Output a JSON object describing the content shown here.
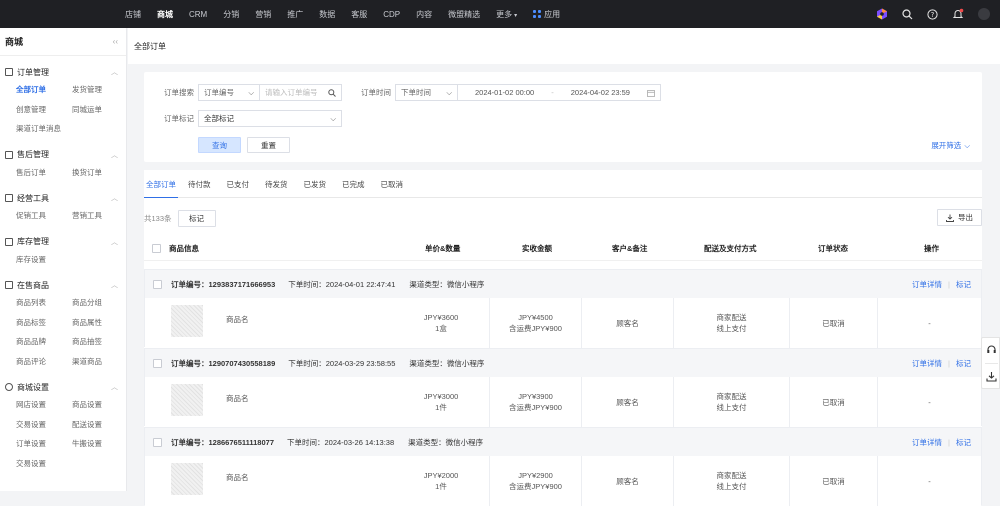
{
  "topnav": {
    "items": [
      "店铺",
      "商城",
      "CRM",
      "分销",
      "营销",
      "推广",
      "数据",
      "客服",
      "CDP",
      "内容",
      "微盟精选",
      "更多"
    ],
    "active": "商城",
    "apps_label": "应用"
  },
  "sidebar": {
    "title": "商城",
    "groups": [
      {
        "name": "订单管理",
        "items": [
          "全部订单",
          "发货管理",
          "创意管理",
          "同城运单",
          "渠道订单消息"
        ]
      },
      {
        "name": "售后管理",
        "items": [
          "售后订单",
          "换货订单"
        ]
      },
      {
        "name": "经营工具",
        "items": [
          "促销工具",
          "营销工具"
        ]
      },
      {
        "name": "库存管理",
        "items": [
          "库存设置"
        ]
      },
      {
        "name": "在售商品",
        "items": [
          "商品列表",
          "商品分组",
          "商品标签",
          "商品属性",
          "商品品牌",
          "商品抽签",
          "商品评论",
          "渠道商品"
        ]
      },
      {
        "name": "商城设置",
        "items": [
          "网店设置",
          "商品设置",
          "交易设置",
          "配送设置",
          "订单设置",
          "牛搬设置",
          "交易设置"
        ]
      }
    ],
    "active_item": "全部订单"
  },
  "breadcrumb": "全部订单",
  "filter": {
    "search_label": "订单搜索",
    "search_type": "订单编号",
    "search_placeholder": "请输入订单编号",
    "time_label": "订单时间",
    "time_type": "下单时间",
    "date_start": "2024-01-02 00:00",
    "date_sep": "-",
    "date_end": "2024-04-02 23:59",
    "mark_label": "订单标记",
    "mark_value": "全部标记",
    "query_button": "查询",
    "reset_button": "重置",
    "expand_label": "展开筛选"
  },
  "tabs": [
    "全部订单",
    "待付款",
    "已支付",
    "待发货",
    "已发货",
    "已完成",
    "已取消"
  ],
  "active_tab": "全部订单",
  "list": {
    "count": "共133条",
    "mark_button": "标记",
    "export_button": "导出",
    "headers": [
      "商品信息",
      "单价&数量",
      "实收金额",
      "客户&备注",
      "配送及支付方式",
      "订单状态",
      "操作"
    ]
  },
  "orders": [
    {
      "no_label": "订单编号：",
      "no": "1293837171666953",
      "time": "下单时间：2024-04-01 22:47:41",
      "channel": "渠道类型：微信小程序",
      "detail": "订单详情",
      "mark": "标记",
      "product": "商品名",
      "price": "JPY¥3600",
      "qty": "1盒",
      "paid": "JPY¥4500",
      "shipping_fee": "含运费JPY¥900",
      "customer": "顾客名",
      "delivery": "商家配送",
      "payment": "线上支付",
      "status": "已取消",
      "action": "-"
    },
    {
      "no_label": "订单编号：",
      "no": "1290707430558189",
      "time": "下单时间：2024-03-29 23:58:55",
      "channel": "渠道类型：微信小程序",
      "detail": "订单详情",
      "mark": "标记",
      "product": "商品名",
      "price": "JPY¥3000",
      "qty": "1件",
      "paid": "JPY¥3900",
      "shipping_fee": "含运费JPY¥900",
      "customer": "顾客名",
      "delivery": "商家配送",
      "payment": "线上支付",
      "status": "已取消",
      "action": "-"
    },
    {
      "no_label": "订单编号：",
      "no": "1286676511118077",
      "time": "下单时间：2024-03-26 14:13:38",
      "channel": "渠道类型：微信小程序",
      "detail": "订单详情",
      "mark": "标记",
      "product": "商品名",
      "price": "JPY¥2000",
      "qty": "1件",
      "paid": "JPY¥2900",
      "shipping_fee": "含运费JPY¥900",
      "customer": "顾客名",
      "delivery": "商家配送",
      "payment": "线上支付",
      "status": "已取消",
      "action": "-"
    }
  ],
  "colors": {
    "accent": "#2f6fe6",
    "topbar": "#1f2024"
  }
}
